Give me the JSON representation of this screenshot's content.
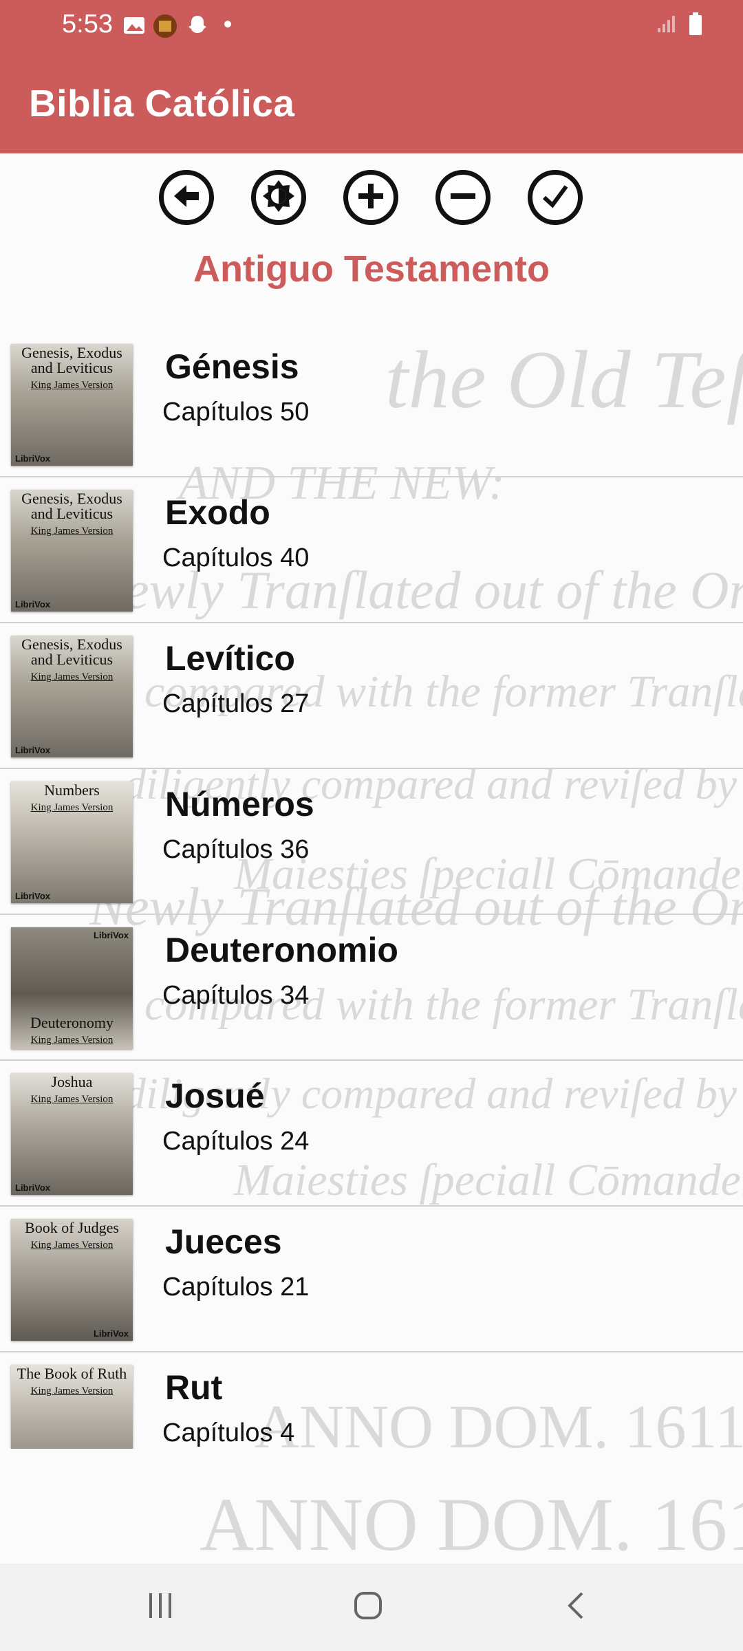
{
  "status": {
    "time": "5:53"
  },
  "app": {
    "title": "Biblia Católica"
  },
  "toolbar": {
    "buttons": [
      {
        "icon": "back-arrow-icon"
      },
      {
        "icon": "brightness-icon"
      },
      {
        "icon": "zoom-in-icon"
      },
      {
        "icon": "zoom-out-icon"
      },
      {
        "icon": "check-icon"
      }
    ]
  },
  "section": {
    "title": "Antiguo Testamento"
  },
  "books": [
    {
      "name": "Génesis",
      "chapters": "Capítulos 50",
      "cover_title": "Genesis, Exodus and Leviticus",
      "cover_sub": "King James Version",
      "cover_brand": "LibriVox"
    },
    {
      "name": "Exodo",
      "chapters": "Capítulos 40",
      "cover_title": "Genesis, Exodus and Leviticus",
      "cover_sub": "King James Version",
      "cover_brand": "LibriVox"
    },
    {
      "name": "Levítico",
      "chapters": "Capítulos 27",
      "cover_title": "Genesis, Exodus and Leviticus",
      "cover_sub": "King James Version",
      "cover_brand": "LibriVox"
    },
    {
      "name": "Números",
      "chapters": "Capítulos 36",
      "cover_title": "Numbers",
      "cover_sub": "King James Version",
      "cover_brand": "LibriVox"
    },
    {
      "name": "Deuteronomio",
      "chapters": "Capítulos 34",
      "cover_title": "Deuteronomy",
      "cover_sub": "King James Version",
      "cover_brand": "LibriVox"
    },
    {
      "name": "Josué",
      "chapters": "Capítulos 24",
      "cover_title": "Joshua",
      "cover_sub": "King James Version",
      "cover_brand": "LibriVox"
    },
    {
      "name": "Jueces",
      "chapters": "Capítulos 21",
      "cover_title": "Book of Judges",
      "cover_sub": "King James Version",
      "cover_brand": "LibriVox"
    },
    {
      "name": "Rut",
      "chapters": "Capítulos 4",
      "cover_title": "The Book of Ruth",
      "cover_sub": "King James Version",
      "cover_brand": ""
    }
  ],
  "colors": {
    "accent": "#cc5b5c",
    "navbar": "#f2f2f2"
  }
}
